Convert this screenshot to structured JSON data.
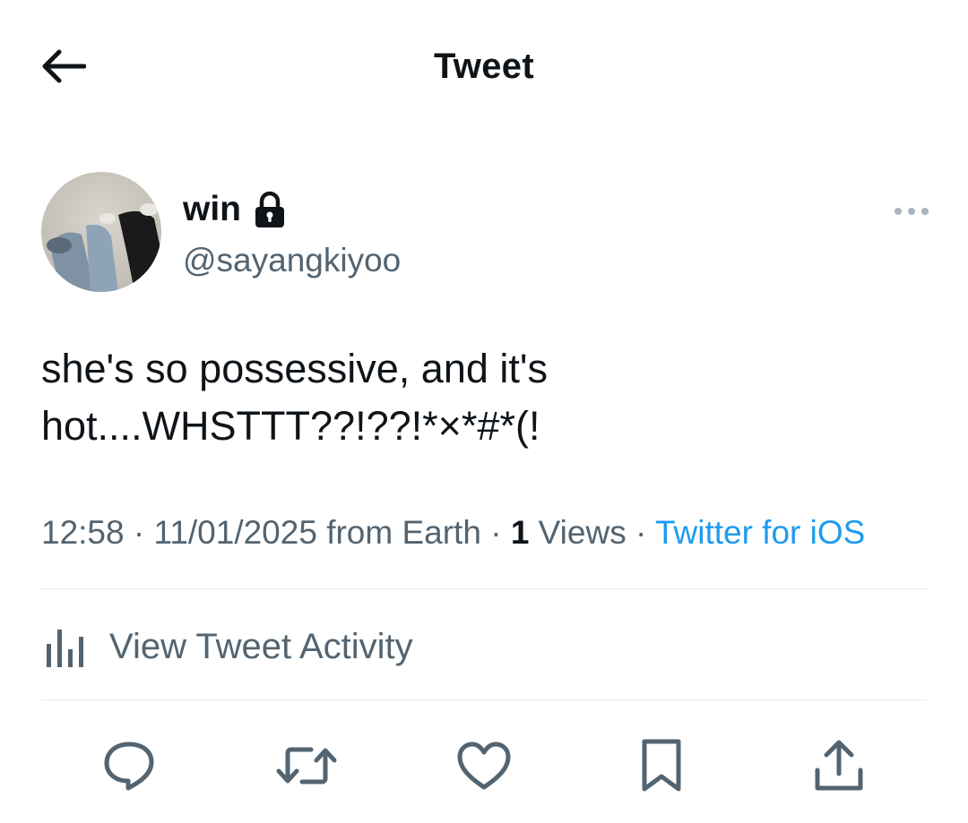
{
  "header": {
    "title": "Tweet"
  },
  "author": {
    "name": "win",
    "handle": "@sayangkiyoo"
  },
  "tweet": {
    "text": "she's so possessive, and it's\nhot....WHSTTT??!??!*×*#*(!"
  },
  "meta": {
    "time": "12:58",
    "date": "11/01/2025",
    "location": "from Earth",
    "sep": "·",
    "views_count": "1",
    "views_label": "Views",
    "source": "Twitter for iOS"
  },
  "activity": {
    "label": "View Tweet Activity"
  },
  "colors": {
    "accent": "#1d9bf0",
    "muted": "#536471",
    "text": "#0f1419",
    "divider": "#e7eaed"
  },
  "icons": {
    "back": "arrow-left-icon",
    "lock": "lock-icon",
    "more": "more-horizontal-icon",
    "activity": "bar-chart-icon",
    "reply": "reply-icon",
    "retweet": "retweet-icon",
    "like": "heart-icon",
    "bookmark": "bookmark-icon",
    "share": "share-icon"
  }
}
